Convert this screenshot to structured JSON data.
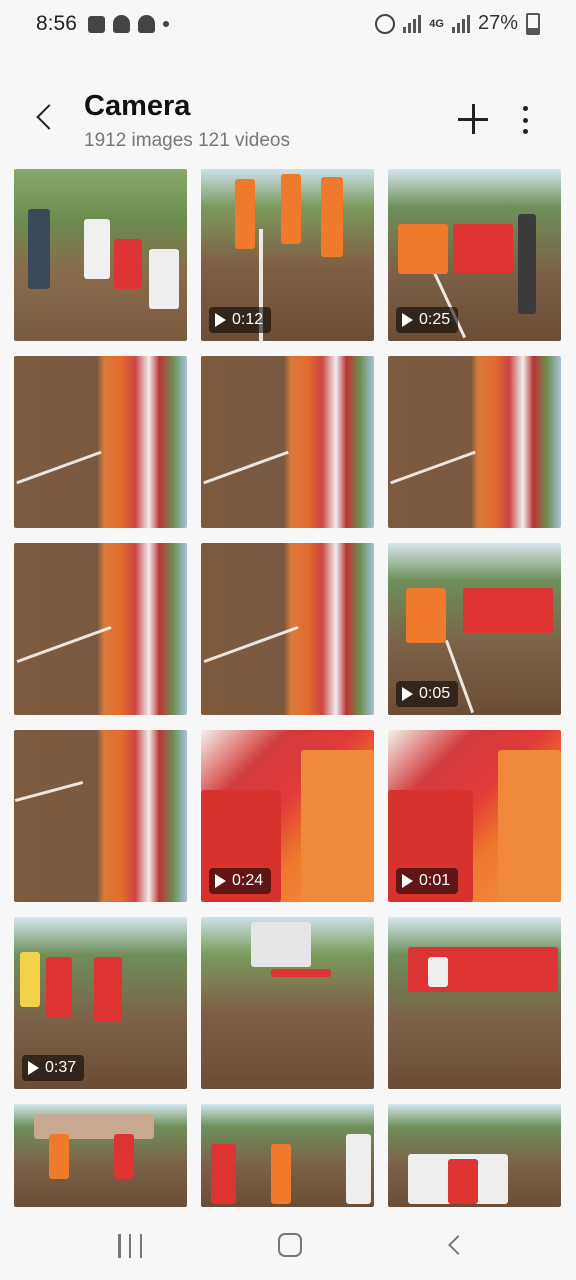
{
  "status_bar": {
    "time": "8:56",
    "network": "4G",
    "battery": "27%"
  },
  "header": {
    "title": "Camera",
    "subtitle": "1912 images 121 videos"
  },
  "grid": {
    "items": [
      {
        "kind": "image",
        "duration": ""
      },
      {
        "kind": "video",
        "duration": "0:12"
      },
      {
        "kind": "video",
        "duration": "0:25"
      },
      {
        "kind": "image",
        "duration": ""
      },
      {
        "kind": "image",
        "duration": ""
      },
      {
        "kind": "image",
        "duration": ""
      },
      {
        "kind": "image",
        "duration": ""
      },
      {
        "kind": "image",
        "duration": ""
      },
      {
        "kind": "video",
        "duration": "0:05"
      },
      {
        "kind": "image",
        "duration": ""
      },
      {
        "kind": "video",
        "duration": "0:24"
      },
      {
        "kind": "video",
        "duration": "0:01"
      },
      {
        "kind": "video",
        "duration": "0:37"
      },
      {
        "kind": "image",
        "duration": ""
      },
      {
        "kind": "image",
        "duration": ""
      },
      {
        "kind": "image",
        "duration": ""
      },
      {
        "kind": "image",
        "duration": ""
      },
      {
        "kind": "image",
        "duration": ""
      }
    ]
  },
  "icons": {
    "back": "chevron-left-icon",
    "add": "plus-icon",
    "more": "more-vertical-icon",
    "play": "play-icon"
  }
}
